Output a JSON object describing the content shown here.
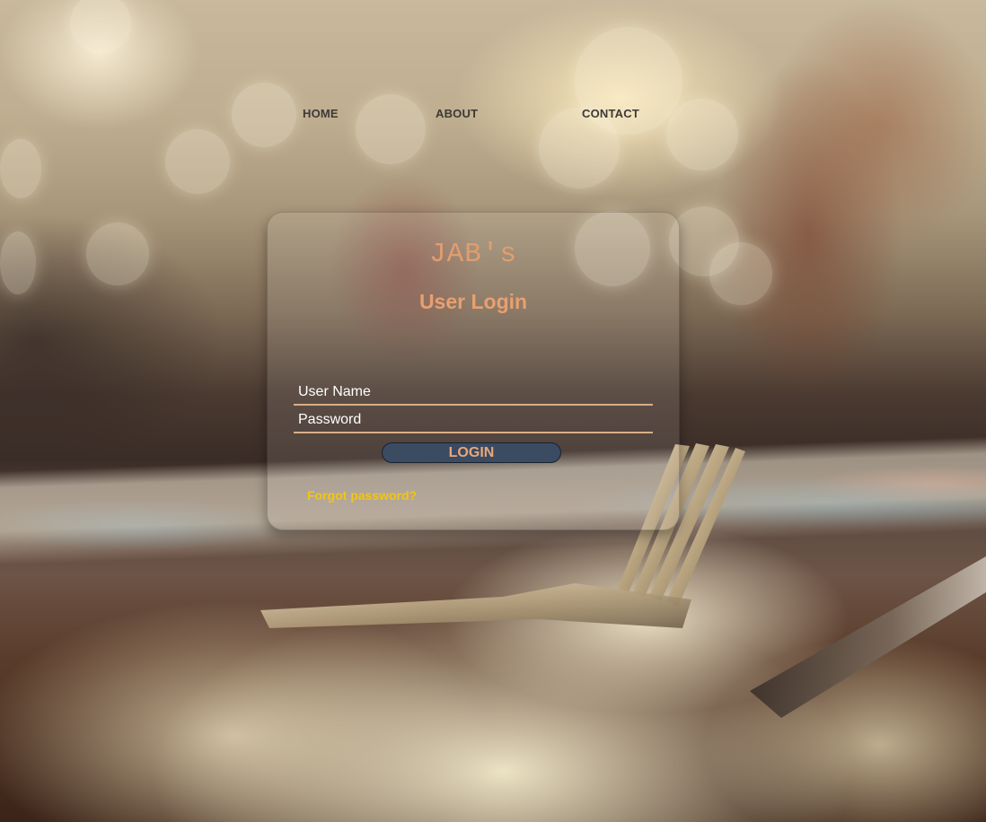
{
  "nav": {
    "home_label": "HOME",
    "about_label": "ABOUT",
    "contact_label": "CONTACT"
  },
  "login": {
    "brand": "JAB's",
    "title": "User Login",
    "username_placeholder": "User Name",
    "password_placeholder": "Password",
    "submit_label": "LOGIN",
    "forgot_label": "Forgot password?"
  },
  "colors": {
    "brand_text": "#e29d6e",
    "title_text": "#e8a070",
    "field_underline": "#d9ae86",
    "button_bg": "#3a4b62",
    "button_text": "#e9a77a",
    "forgot_link": "#f2c514",
    "nav_text": "#3c3a36"
  }
}
